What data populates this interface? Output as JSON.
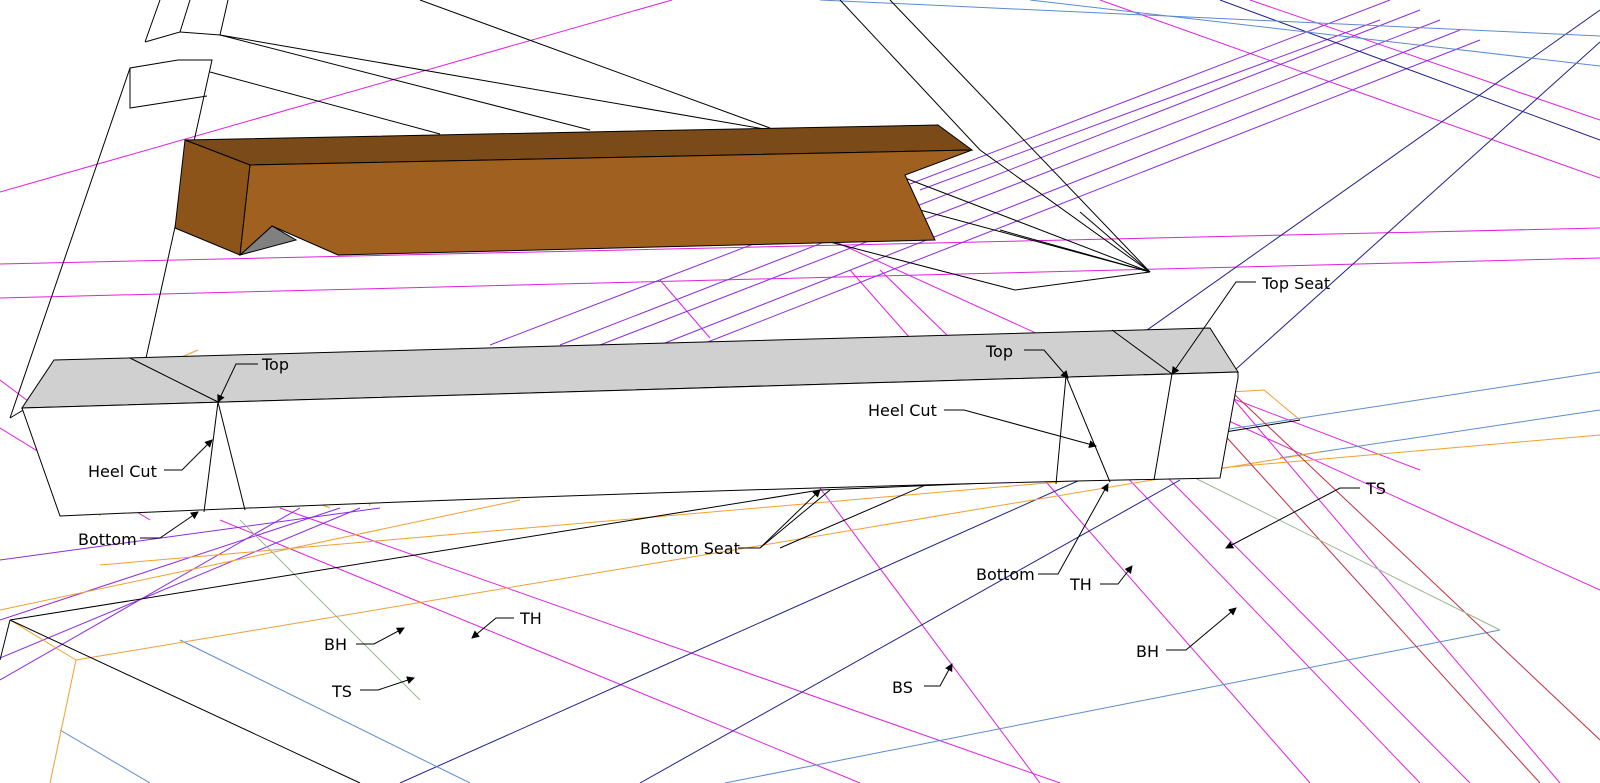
{
  "colors": {
    "background": "#ffffff",
    "edge": "#000000",
    "magenta": "#e020e0",
    "purple": "#8a2be2",
    "navy": "#20208a",
    "blue": "#5b8bd0",
    "orange": "#f0a030",
    "red": "#c03040",
    "green": "#9aba90",
    "gray": "#aaaaaa",
    "wood_face": "#a0601f",
    "wood_top": "#7a4a18",
    "wood_shadow": "#808080",
    "beam_top": "#d0d0d0"
  },
  "labels": {
    "top_left": "Top",
    "heel_cut_left": "Heel Cut",
    "bottom_left": "Bottom",
    "bh_left": "BH",
    "th_left": "TH",
    "ts_left": "TS",
    "bottom_seat": "Bottom Seat",
    "bs": "BS",
    "top_right": "Top",
    "top_seat": "Top Seat",
    "heel_cut_right": "Heel Cut",
    "bottom_right": "Bottom",
    "th_right": "TH",
    "ts_right": "TS",
    "bh_right": "BH"
  }
}
